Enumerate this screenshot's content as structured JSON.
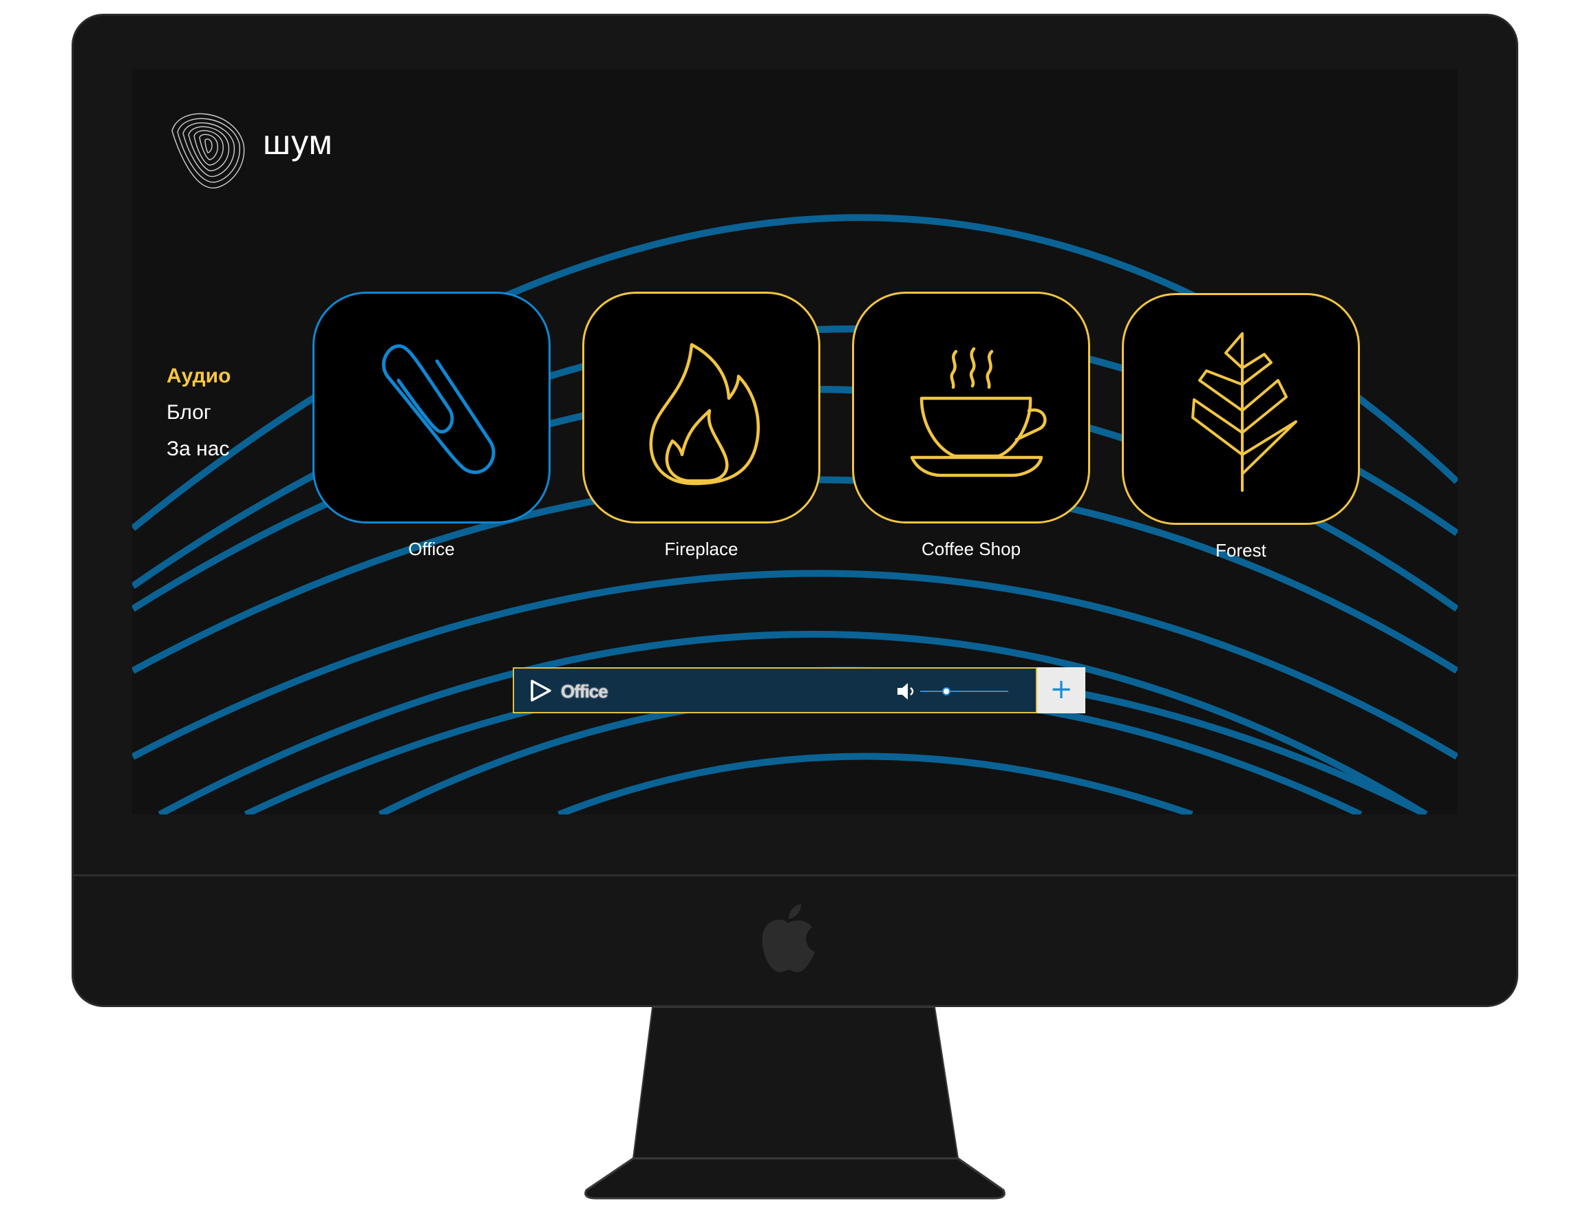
{
  "brand": {
    "name": "шум",
    "logo_icon": "fingerprint-swirl-icon"
  },
  "nav": {
    "items": [
      {
        "label": "Аудио",
        "active": true
      },
      {
        "label": "Блог",
        "active": false
      },
      {
        "label": "За нас",
        "active": false
      }
    ]
  },
  "tiles": [
    {
      "label": "Office",
      "icon": "paperclip-icon",
      "active": true
    },
    {
      "label": "Fireplace",
      "icon": "flame-icon",
      "active": false
    },
    {
      "label": "Coffee Shop",
      "icon": "coffee-cup-icon",
      "active": false
    },
    {
      "label": "Forest",
      "icon": "leaf-icon",
      "active": false
    }
  ],
  "player": {
    "track": "Office",
    "volume": 0.3,
    "add_label": "+"
  },
  "colors": {
    "accent_yellow": "#f1c542",
    "accent_blue": "#1186d1",
    "wave_blue": "#0a6394",
    "background": "#111111"
  }
}
